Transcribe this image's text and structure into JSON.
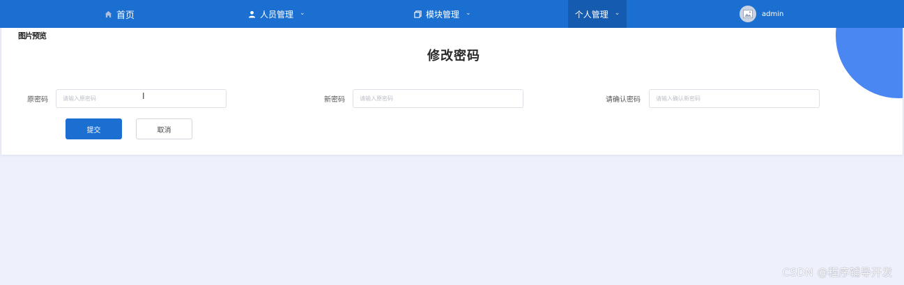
{
  "nav": {
    "home": {
      "label": "首页",
      "icon": "home-icon"
    },
    "people": {
      "label": "人员管理",
      "icon": "user-icon"
    },
    "module": {
      "label": "模块管理",
      "icon": "module-icon"
    },
    "personal": {
      "label": "个人管理"
    },
    "user": {
      "name": "admin",
      "avatar_icon": "image-placeholder-icon"
    }
  },
  "page": {
    "broken_image_alt": "图片预览",
    "title": "修改密码"
  },
  "form": {
    "old_password": {
      "label": "原密码",
      "placeholder": "请输入原密码",
      "value": ""
    },
    "new_password": {
      "label": "新密码",
      "placeholder": "请输入原密码",
      "value": ""
    },
    "confirm_password": {
      "label": "请确认密码",
      "placeholder": "请输入确认新密码",
      "value": ""
    }
  },
  "buttons": {
    "submit": "提交",
    "cancel": "取消"
  },
  "watermark": "CSDN @程序辅导开发",
  "colors": {
    "nav_bg": "#1a6fd1",
    "nav_active_bg": "#155bb0",
    "primary": "#1a6fd1",
    "page_bg": "#eef0fb",
    "decor_circle": "#4a87f2"
  }
}
